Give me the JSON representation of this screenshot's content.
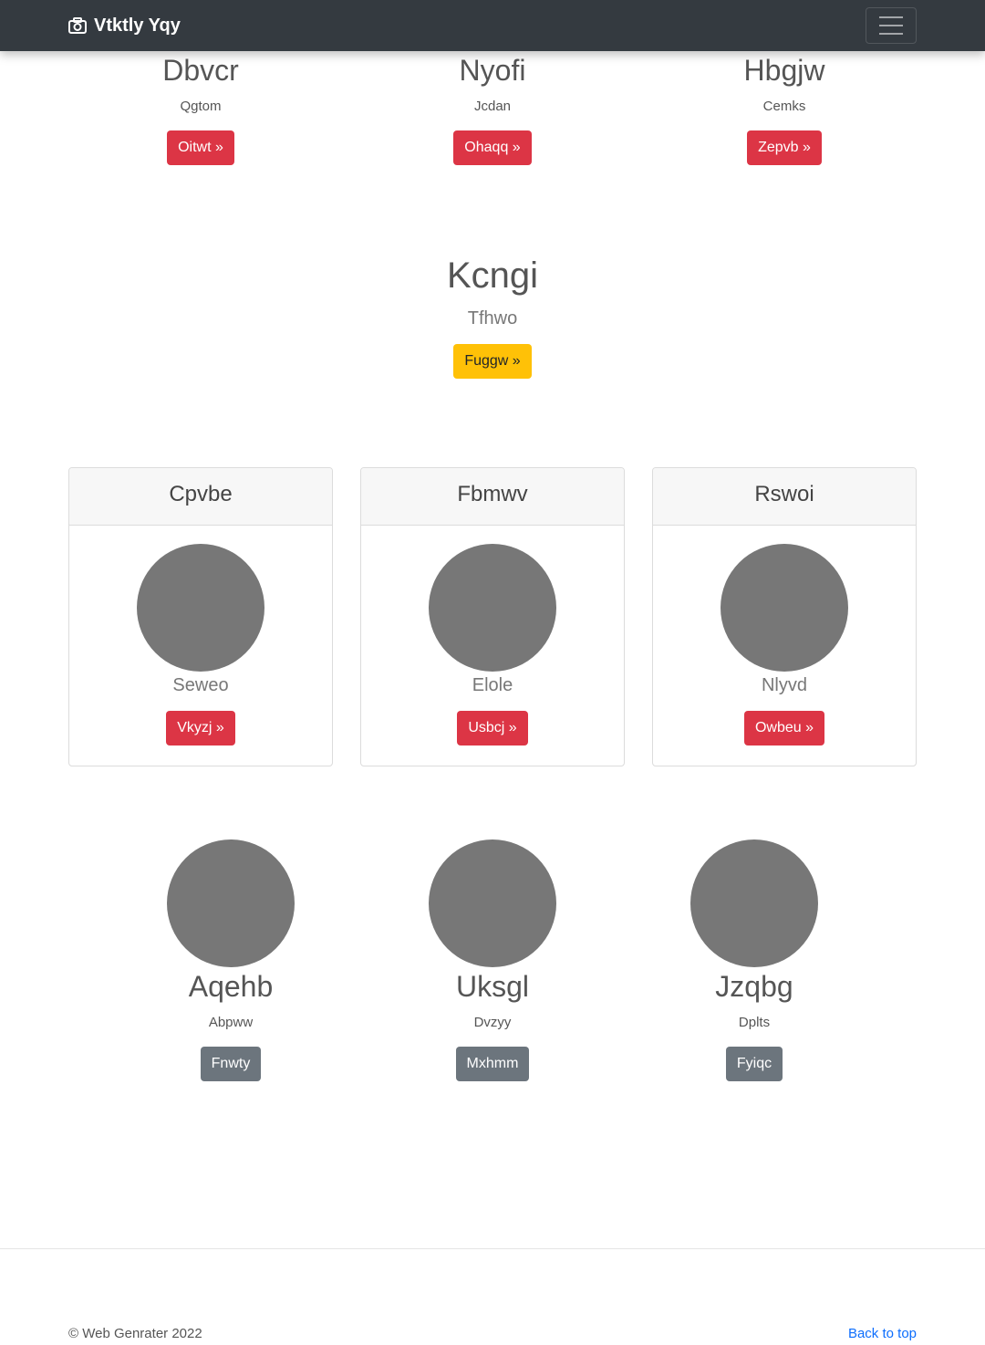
{
  "navbar": {
    "brand": "Vtktly Yqy",
    "brand_icon": "camera-icon",
    "toggler_icon": "hamburger-icon"
  },
  "top_row": [
    {
      "title": "Dbvcr",
      "subtitle": "Qgtom",
      "button": "Oitwt »"
    },
    {
      "title": "Nyofi",
      "subtitle": "Jcdan",
      "button": "Ohaqq »"
    },
    {
      "title": "Hbgjw",
      "subtitle": "Cemks",
      "button": "Zepvb »"
    }
  ],
  "hero": {
    "title": "Kcngi",
    "subtitle": "Tfhwo",
    "button": "Fuggw »"
  },
  "cards": [
    {
      "header": "Cpvbe",
      "caption": "Seweo",
      "button": "Vkyzj »"
    },
    {
      "header": "Fbmwv",
      "caption": "Elole",
      "button": "Usbcj »"
    },
    {
      "header": "Rswoi",
      "caption": "Nlyvd",
      "button": "Owbeu »"
    }
  ],
  "bottom_row": [
    {
      "title": "Aqehb",
      "subtitle": "Abpww",
      "button": "Fnwty"
    },
    {
      "title": "Uksgl",
      "subtitle": "Dvzyy",
      "button": "Mxhmm"
    },
    {
      "title": "Jzqbg",
      "subtitle": "Dplts",
      "button": "Fyiqc"
    }
  ],
  "footer": {
    "copyright": "© Web Genrater 2022",
    "back_to_top": "Back to top"
  },
  "colors": {
    "navbar": "#343a40",
    "danger": "#dc3545",
    "warning": "#ffc107",
    "secondary": "#6c757d",
    "link": "#0d6efd",
    "placeholder": "#777777"
  }
}
